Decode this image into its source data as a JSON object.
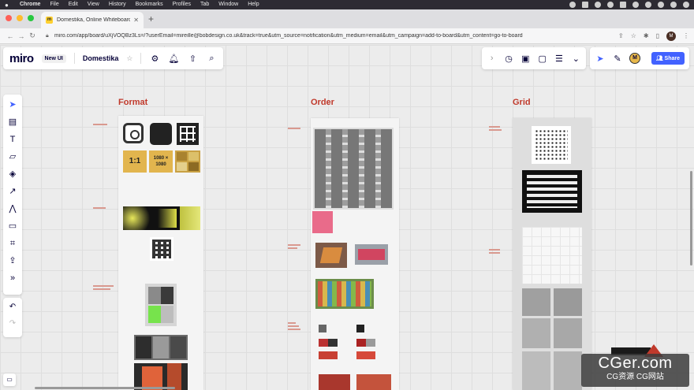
{
  "menubar": {
    "app": "Chrome",
    "items": [
      "File",
      "Edit",
      "View",
      "History",
      "Bookmarks",
      "Profiles",
      "Tab",
      "Window",
      "Help"
    ]
  },
  "browser": {
    "tab_title": "Domestika, Online Whiteboard",
    "url": "miro.com/app/board/uXjVOQBz3Ls=/?userEmail=mireille@bobdesign.co.uk&track=true&utm_source=notification&utm_medium=email&utm_campaign=add-to-board&utm_content=go-to-board",
    "profile_initial": "M"
  },
  "miro": {
    "logo": "miro",
    "new_ui_badge": "New UI",
    "board_name": "Domestika",
    "share_label": "Share",
    "user_initial": "M",
    "accent_color": "#4262ff"
  },
  "canvas": {
    "headings": {
      "format": "Format",
      "order": "Order",
      "grid": "Grid"
    },
    "format_cards": {
      "ratio_1_1": "1:1",
      "size_a": "1080 × 1080",
      "size_b": "1080 × 1080"
    }
  },
  "watermark": {
    "big": "CGer.com",
    "small": "CG资源 CG网站"
  }
}
